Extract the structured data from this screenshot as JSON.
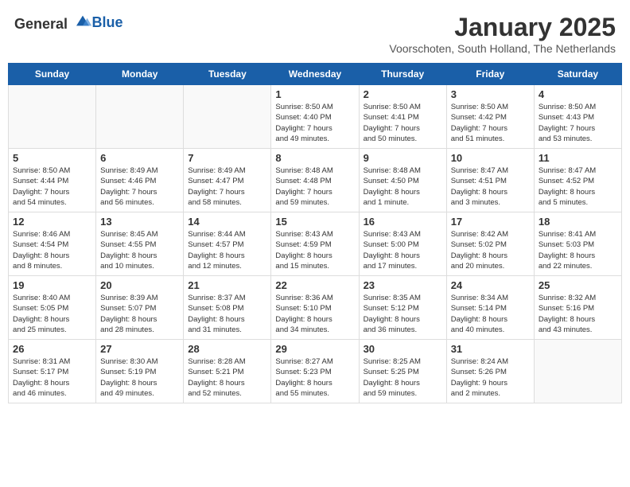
{
  "header": {
    "logo_general": "General",
    "logo_blue": "Blue",
    "month_title": "January 2025",
    "subtitle": "Voorschoten, South Holland, The Netherlands"
  },
  "weekdays": [
    "Sunday",
    "Monday",
    "Tuesday",
    "Wednesday",
    "Thursday",
    "Friday",
    "Saturday"
  ],
  "weeks": [
    [
      {
        "day": "",
        "info": ""
      },
      {
        "day": "",
        "info": ""
      },
      {
        "day": "",
        "info": ""
      },
      {
        "day": "1",
        "info": "Sunrise: 8:50 AM\nSunset: 4:40 PM\nDaylight: 7 hours\nand 49 minutes."
      },
      {
        "day": "2",
        "info": "Sunrise: 8:50 AM\nSunset: 4:41 PM\nDaylight: 7 hours\nand 50 minutes."
      },
      {
        "day": "3",
        "info": "Sunrise: 8:50 AM\nSunset: 4:42 PM\nDaylight: 7 hours\nand 51 minutes."
      },
      {
        "day": "4",
        "info": "Sunrise: 8:50 AM\nSunset: 4:43 PM\nDaylight: 7 hours\nand 53 minutes."
      }
    ],
    [
      {
        "day": "5",
        "info": "Sunrise: 8:50 AM\nSunset: 4:44 PM\nDaylight: 7 hours\nand 54 minutes."
      },
      {
        "day": "6",
        "info": "Sunrise: 8:49 AM\nSunset: 4:46 PM\nDaylight: 7 hours\nand 56 minutes."
      },
      {
        "day": "7",
        "info": "Sunrise: 8:49 AM\nSunset: 4:47 PM\nDaylight: 7 hours\nand 58 minutes."
      },
      {
        "day": "8",
        "info": "Sunrise: 8:48 AM\nSunset: 4:48 PM\nDaylight: 7 hours\nand 59 minutes."
      },
      {
        "day": "9",
        "info": "Sunrise: 8:48 AM\nSunset: 4:50 PM\nDaylight: 8 hours\nand 1 minute."
      },
      {
        "day": "10",
        "info": "Sunrise: 8:47 AM\nSunset: 4:51 PM\nDaylight: 8 hours\nand 3 minutes."
      },
      {
        "day": "11",
        "info": "Sunrise: 8:47 AM\nSunset: 4:52 PM\nDaylight: 8 hours\nand 5 minutes."
      }
    ],
    [
      {
        "day": "12",
        "info": "Sunrise: 8:46 AM\nSunset: 4:54 PM\nDaylight: 8 hours\nand 8 minutes."
      },
      {
        "day": "13",
        "info": "Sunrise: 8:45 AM\nSunset: 4:55 PM\nDaylight: 8 hours\nand 10 minutes."
      },
      {
        "day": "14",
        "info": "Sunrise: 8:44 AM\nSunset: 4:57 PM\nDaylight: 8 hours\nand 12 minutes."
      },
      {
        "day": "15",
        "info": "Sunrise: 8:43 AM\nSunset: 4:59 PM\nDaylight: 8 hours\nand 15 minutes."
      },
      {
        "day": "16",
        "info": "Sunrise: 8:43 AM\nSunset: 5:00 PM\nDaylight: 8 hours\nand 17 minutes."
      },
      {
        "day": "17",
        "info": "Sunrise: 8:42 AM\nSunset: 5:02 PM\nDaylight: 8 hours\nand 20 minutes."
      },
      {
        "day": "18",
        "info": "Sunrise: 8:41 AM\nSunset: 5:03 PM\nDaylight: 8 hours\nand 22 minutes."
      }
    ],
    [
      {
        "day": "19",
        "info": "Sunrise: 8:40 AM\nSunset: 5:05 PM\nDaylight: 8 hours\nand 25 minutes."
      },
      {
        "day": "20",
        "info": "Sunrise: 8:39 AM\nSunset: 5:07 PM\nDaylight: 8 hours\nand 28 minutes."
      },
      {
        "day": "21",
        "info": "Sunrise: 8:37 AM\nSunset: 5:08 PM\nDaylight: 8 hours\nand 31 minutes."
      },
      {
        "day": "22",
        "info": "Sunrise: 8:36 AM\nSunset: 5:10 PM\nDaylight: 8 hours\nand 34 minutes."
      },
      {
        "day": "23",
        "info": "Sunrise: 8:35 AM\nSunset: 5:12 PM\nDaylight: 8 hours\nand 36 minutes."
      },
      {
        "day": "24",
        "info": "Sunrise: 8:34 AM\nSunset: 5:14 PM\nDaylight: 8 hours\nand 40 minutes."
      },
      {
        "day": "25",
        "info": "Sunrise: 8:32 AM\nSunset: 5:16 PM\nDaylight: 8 hours\nand 43 minutes."
      }
    ],
    [
      {
        "day": "26",
        "info": "Sunrise: 8:31 AM\nSunset: 5:17 PM\nDaylight: 8 hours\nand 46 minutes."
      },
      {
        "day": "27",
        "info": "Sunrise: 8:30 AM\nSunset: 5:19 PM\nDaylight: 8 hours\nand 49 minutes."
      },
      {
        "day": "28",
        "info": "Sunrise: 8:28 AM\nSunset: 5:21 PM\nDaylight: 8 hours\nand 52 minutes."
      },
      {
        "day": "29",
        "info": "Sunrise: 8:27 AM\nSunset: 5:23 PM\nDaylight: 8 hours\nand 55 minutes."
      },
      {
        "day": "30",
        "info": "Sunrise: 8:25 AM\nSunset: 5:25 PM\nDaylight: 8 hours\nand 59 minutes."
      },
      {
        "day": "31",
        "info": "Sunrise: 8:24 AM\nSunset: 5:26 PM\nDaylight: 9 hours\nand 2 minutes."
      },
      {
        "day": "",
        "info": ""
      }
    ]
  ]
}
